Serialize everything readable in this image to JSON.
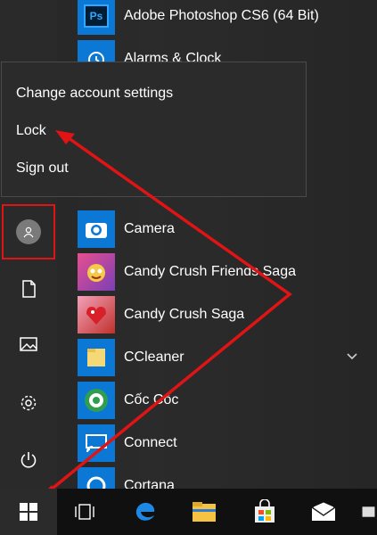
{
  "apps": [
    {
      "label": "Adobe Photoshop CS6 (64 Bit)",
      "icon": "photoshop-icon",
      "tile_text": "Ps",
      "color": "#001d34"
    },
    {
      "label": "Alarms & Clock",
      "icon": "alarm-clock-icon",
      "color": "#0a78d4"
    },
    {
      "label": "Camera",
      "icon": "camera-icon",
      "color": "#0a78d4"
    },
    {
      "label": "Candy Crush Friends Saga",
      "icon": "candy-crush-friends-icon",
      "color": "#7b3fb5"
    },
    {
      "label": "Candy Crush Saga",
      "icon": "candy-crush-icon",
      "color": "#c0302c"
    },
    {
      "label": "CCleaner",
      "icon": "folder-icon",
      "color": "#0a78d4"
    },
    {
      "label": "Cốc Cốc",
      "icon": "coccoc-icon",
      "color": "#1f7a3e"
    },
    {
      "label": "Connect",
      "icon": "connect-icon",
      "color": "#0a78d4"
    },
    {
      "label": "Cortana",
      "icon": "cortana-icon",
      "color": "#0a78d4"
    }
  ],
  "account_menu": {
    "items": [
      "Change account settings",
      "Lock",
      "Sign out"
    ]
  },
  "rail": [
    "user-avatar-icon",
    "document-icon",
    "pictures-icon",
    "settings-gear-icon",
    "power-icon"
  ],
  "taskbar": [
    "windows-start-icon",
    "task-view-icon",
    "edge-icon",
    "file-explorer-icon",
    "store-icon",
    "mail-icon"
  ],
  "colors": {
    "accent": "#0a78d4",
    "highlight": "#e01414"
  }
}
